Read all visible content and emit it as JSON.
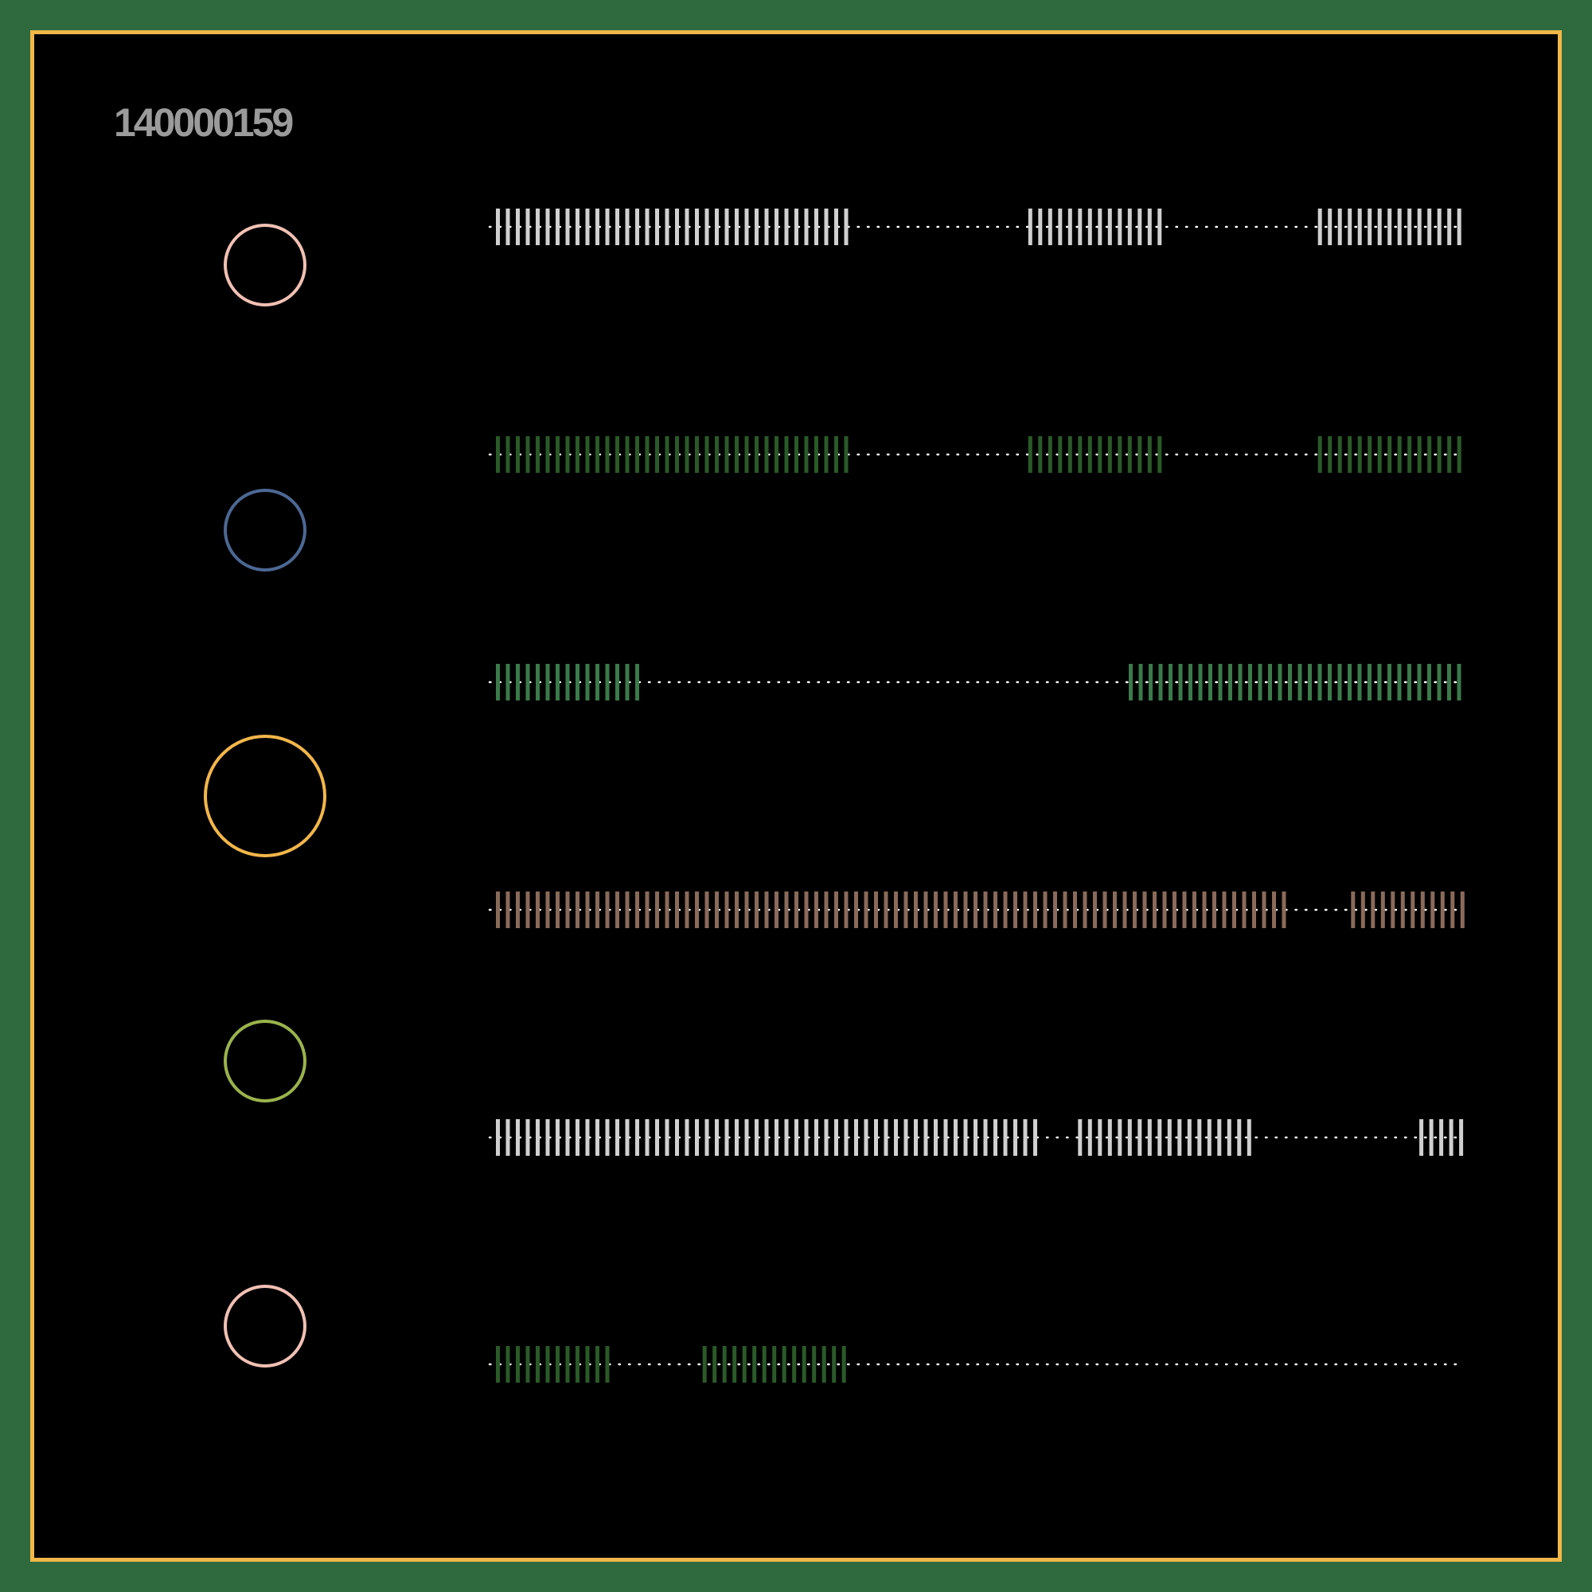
{
  "code": "140000159",
  "colors": {
    "page_background": "#2f6a3f",
    "frame_border": "#f2b64a",
    "panel_background": "#000000",
    "code_text": "#9b9b9b",
    "dot_line": "#ffffff"
  },
  "circles": [
    {
      "color": "#f2c0b4",
      "size": "small"
    },
    {
      "color": "#4c6894",
      "size": "small"
    },
    {
      "color": "#f2b64a",
      "size": "large"
    },
    {
      "color": "#9ab34c",
      "size": "small"
    },
    {
      "color": "#f2c0b4",
      "size": "small"
    }
  ],
  "rows": [
    {
      "color": "#d0d0d0",
      "segments": [
        [
          0.0,
          0.369
        ],
        [
          0.546,
          0.694
        ],
        [
          0.843,
          1.0
        ]
      ]
    },
    {
      "color": "#2a5a28",
      "segments": [
        [
          0.0,
          0.369
        ],
        [
          0.546,
          0.694
        ],
        [
          0.843,
          1.0
        ]
      ]
    },
    {
      "color": "#3b7a4a",
      "segments": [
        [
          0.0,
          0.163
        ],
        [
          0.649,
          1.0
        ]
      ]
    },
    {
      "color": "#8a6a5a",
      "segments": [
        [
          0.0,
          0.82
        ],
        [
          0.877,
          1.0
        ]
      ]
    },
    {
      "color": "#d0d0d0",
      "segments": [
        [
          0.0,
          0.562
        ],
        [
          0.597,
          0.788
        ],
        [
          0.947,
          1.0
        ]
      ]
    },
    {
      "color": "#2a5a28",
      "segments": [
        [
          0.0,
          0.128
        ],
        [
          0.212,
          0.372
        ]
      ]
    }
  ]
}
